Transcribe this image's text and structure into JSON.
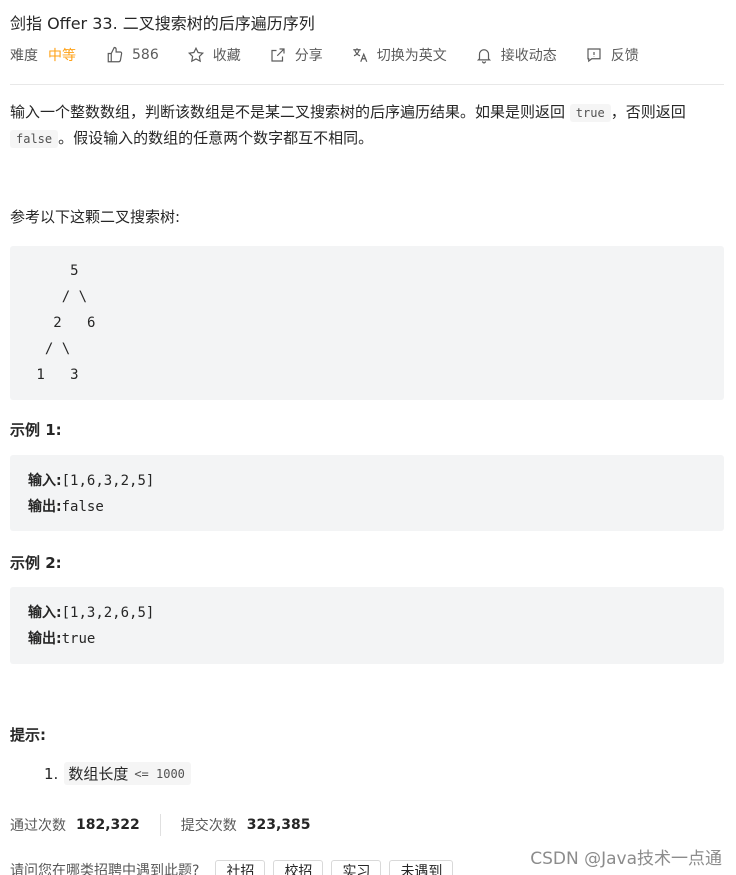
{
  "problem": {
    "title": "剑指 Offer 33. 二叉搜索树的后序遍历序列",
    "difficulty_label": "难度",
    "difficulty": "中等",
    "likes": "586",
    "collect_label": "收藏",
    "share_label": "分享",
    "switch_lang_label": "切换为英文",
    "subscribe_label": "接收动态",
    "feedback_label": "反馈"
  },
  "description": {
    "part1": "输入一个整数数组，判断该数组是不是某二叉搜索树的后序遍历结果。如果是则返回 ",
    "code_true": "true",
    "part2": "，否则返回 ",
    "code_false": "false",
    "part3": "。假设输入的数组的任意两个数字都互不相同。",
    "ref_line": "参考以下这颗二叉搜索树:"
  },
  "tree_text": "     5\n    / \\\n   2   6\n  / \\\n 1   3",
  "examples": [
    {
      "title": "示例 1:",
      "input_label": "输入:",
      "input": "[1,6,3,2,5]",
      "output_label": "输出:",
      "output": "false"
    },
    {
      "title": "示例 2:",
      "input_label": "输入:",
      "input": "[1,3,2,6,5]",
      "output_label": "输出:",
      "output": "true"
    }
  ],
  "hints": {
    "title": "提示:",
    "items": [
      {
        "num": "1.",
        "text": "数组长度",
        "code": "<= 1000"
      }
    ]
  },
  "stats": {
    "accepted_label": "通过次数",
    "accepted": "182,322",
    "submitted_label": "提交次数",
    "submitted": "323,385"
  },
  "interview": {
    "question": "请问您在哪类招聘中遇到此题?",
    "tags": [
      "社招",
      "校招",
      "实习",
      "未遇到"
    ]
  },
  "watermark": "CSDN @Java技术一点通",
  "colors": {
    "difficulty_medium": "#ffa116",
    "code_bg": "#f3f4f5"
  }
}
